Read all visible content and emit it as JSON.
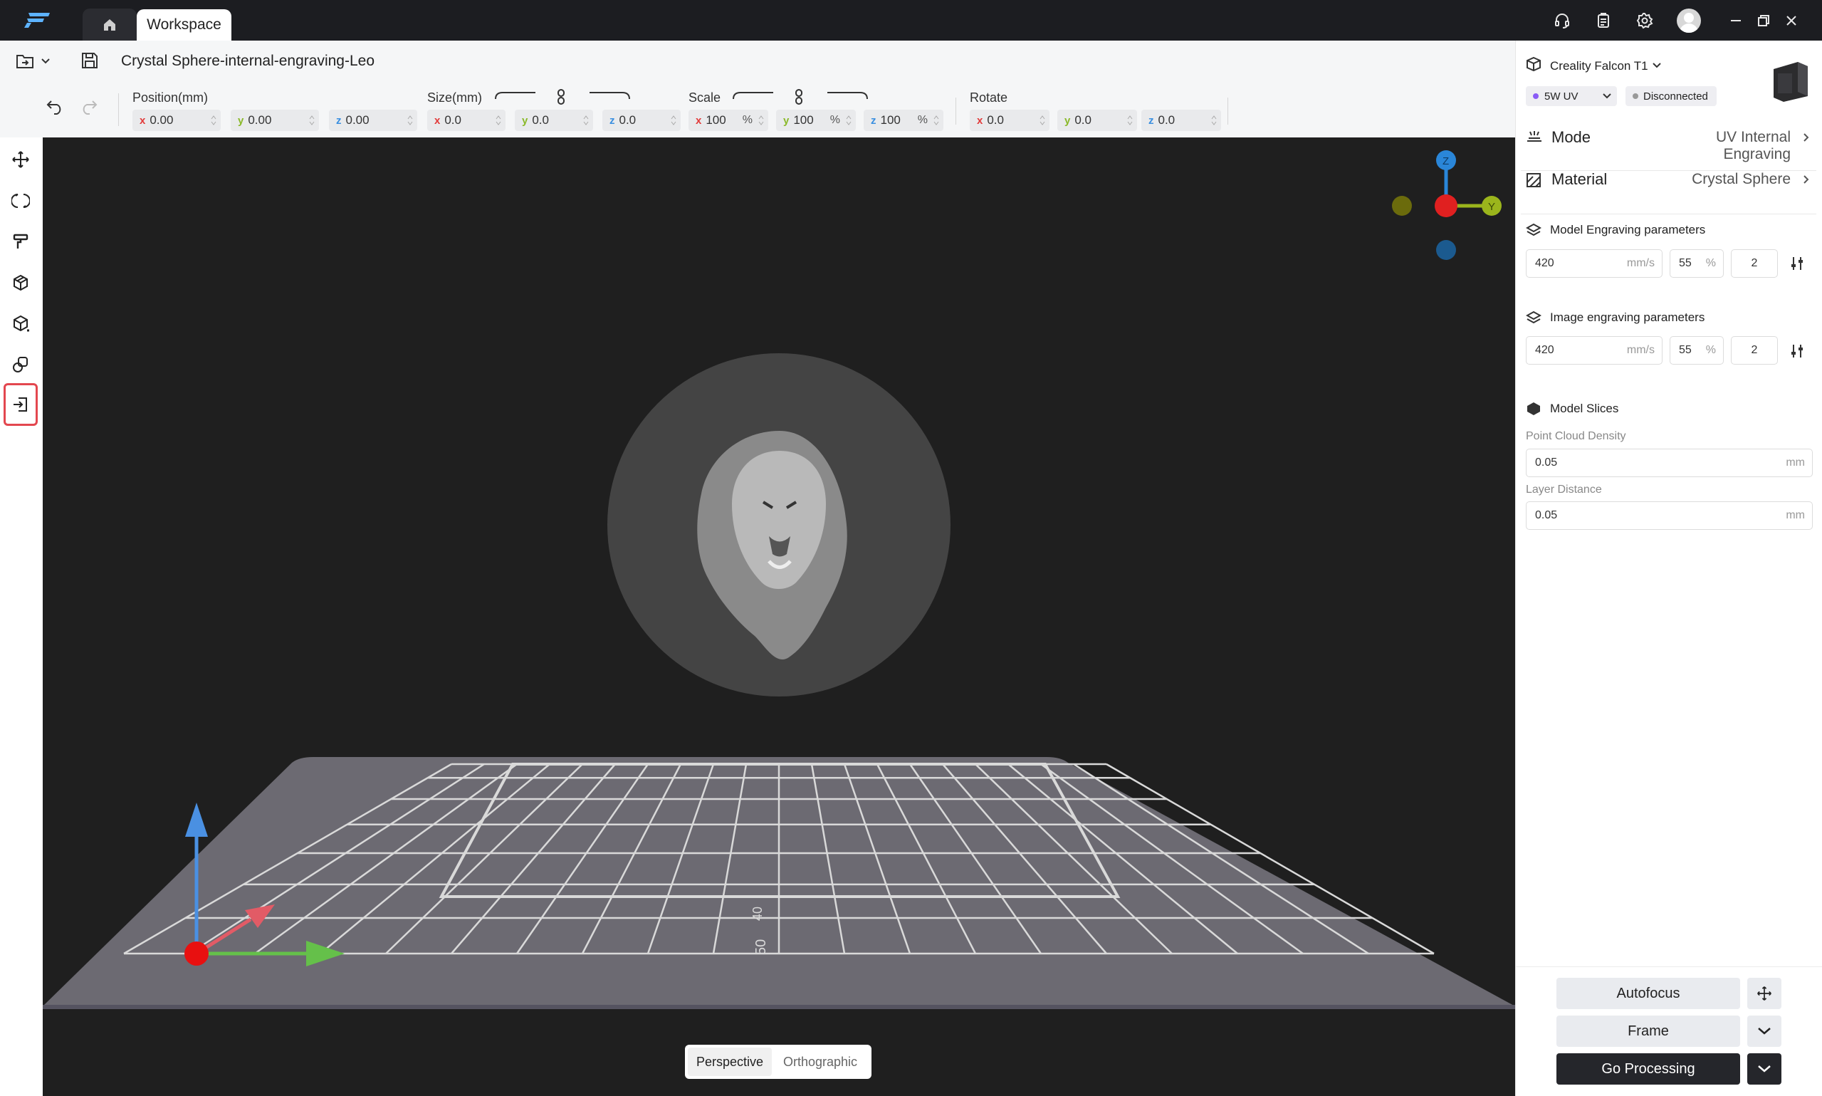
{
  "titlebar": {
    "home_tab_icon": "home-icon",
    "workspace_tab": "Workspace",
    "icons": [
      "headset-icon",
      "clipboard-icon",
      "gear-icon",
      "avatar",
      "minimize-icon",
      "restore-icon",
      "close-icon"
    ]
  },
  "filebar": {
    "title": "Crystal Sphere-internal-engraving-Leo"
  },
  "toolbar": {
    "position_label": "Position(mm)",
    "size_label": "Size(mm)",
    "scale_label": "Scale",
    "rotate_label": "Rotate",
    "axis_x": "x",
    "axis_y": "y",
    "axis_z": "z",
    "percent": "%",
    "position": {
      "x": "0.00",
      "y": "0.00",
      "z": "0.00"
    },
    "size": {
      "x": "0.0",
      "y": "0.0",
      "z": "0.0"
    },
    "scale": {
      "x": "100",
      "y": "100",
      "z": "100"
    },
    "rotate": {
      "x": "0.0",
      "y": "0.0",
      "z": "0.0"
    }
  },
  "viewport": {
    "perspective": "Perspective",
    "orthographic": "Orthographic",
    "active_view": "Perspective",
    "gizmo": {
      "z": "Z",
      "y": "Y"
    },
    "grid_ticks": [
      "40",
      "50"
    ]
  },
  "panel": {
    "device_name": "Creality Falcon T1",
    "laser": "5W UV",
    "status": "Disconnected",
    "mode_label": "Mode",
    "mode_value": "UV Internal Engraving",
    "material_label": "Material",
    "material_value": "Crystal Sphere",
    "model_params_title": "Model Engraving parameters",
    "model_speed": "420",
    "model_speed_unit": "mm/s",
    "model_power": "55",
    "model_power_unit": "%",
    "model_passes": "2",
    "image_params_title": "Image engraving parameters",
    "image_speed": "420",
    "image_speed_unit": "mm/s",
    "image_power": "55",
    "image_power_unit": "%",
    "image_passes": "2",
    "slices_title": "Model Slices",
    "point_cloud_label": "Point Cloud Density",
    "point_cloud_value": "0.05",
    "point_cloud_unit": "mm",
    "layer_distance_label": "Layer Distance",
    "layer_distance_value": "0.05",
    "layer_distance_unit": "mm"
  },
  "actions": {
    "autofocus": "Autofocus",
    "frame": "Frame",
    "go_processing": "Go Processing"
  },
  "colors": {
    "accent_red": "#e3474f",
    "status_dot": "#8a5cf6",
    "gizmo_x": "#e02020",
    "gizmo_y": "#9bb51c",
    "gizmo_z": "#2a86d8"
  }
}
